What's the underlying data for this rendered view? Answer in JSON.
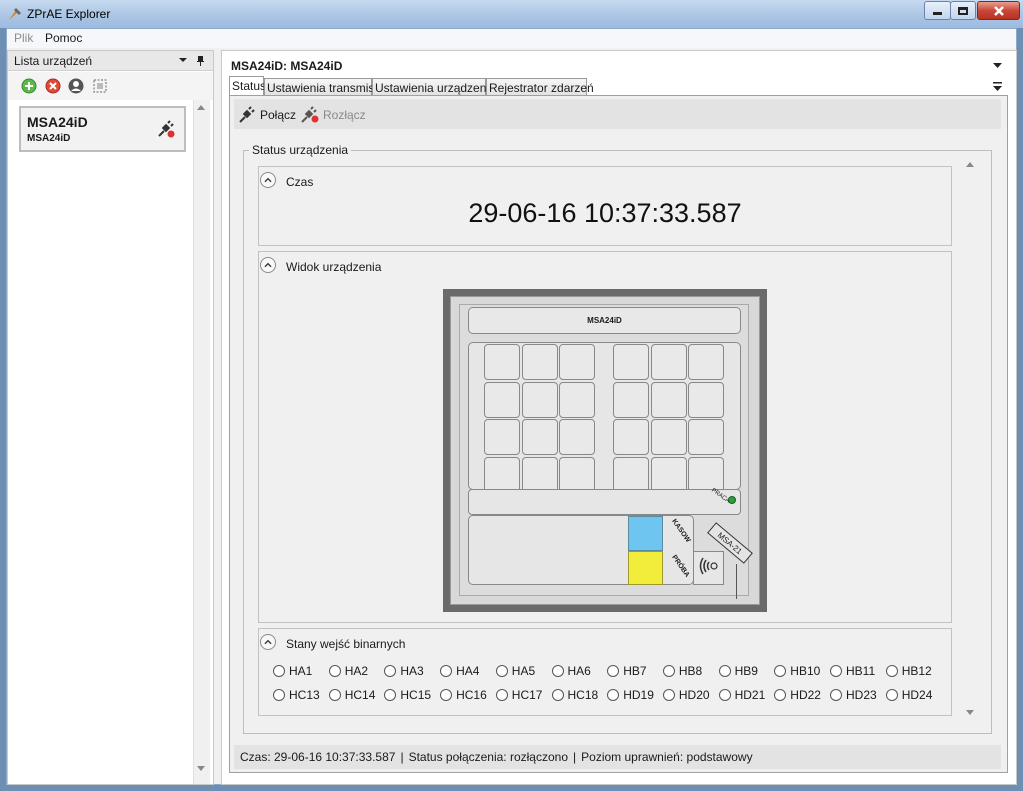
{
  "window": {
    "title": "ZPrAE Explorer"
  },
  "menu": [
    "Plik",
    "Pomoc"
  ],
  "left_panel": {
    "header": "Lista urządzeń",
    "toolbar_icons": [
      "add-icon",
      "remove-icon",
      "user-icon",
      "select-icon"
    ],
    "device": {
      "name": "MSA24iD",
      "subname": "MSA24iD"
    }
  },
  "right_panel": {
    "title": "MSA24iD: MSA24iD",
    "tabs": [
      "Status",
      "Ustawienia transmisji",
      "Ustawienia urządzenia",
      "Rejestrator zdarzeń"
    ],
    "toolbar": {
      "connect": "Połącz",
      "disconnect": "Rozłącz"
    },
    "group_title": "Status urządzenia",
    "sections": {
      "time": {
        "label": "Czas",
        "value": "29-06-16 10:37:33.587"
      },
      "device_view": {
        "label": "Widok urządzenia"
      },
      "inputs": {
        "label": "Stany wejść binarnych"
      }
    },
    "device_panel": {
      "model": "MSA24iD",
      "praca": "PRACA",
      "kasow": "KASOW",
      "proba": "PRÓBA",
      "sticker": "MSA-21",
      "button_colors": {
        "kasow": "#6ec6f0",
        "proba": "#f2ec3a",
        "praca_led": "#2e9e3a"
      }
    },
    "binary_inputs": [
      [
        "HA1",
        "HA2",
        "HA3",
        "HA4",
        "HA5",
        "HA6",
        "HB7",
        "HB8",
        "HB9",
        "HB10",
        "HB11",
        "HB12"
      ],
      [
        "HC13",
        "HC14",
        "HC15",
        "HC16",
        "HC17",
        "HC18",
        "HD19",
        "HD20",
        "HD21",
        "HD22",
        "HD23",
        "HD24"
      ]
    ],
    "status_bar": {
      "time": "Czas: 29-06-16 10:37:33.587",
      "sep1": "|",
      "connection": "Status połączenia: rozłączono",
      "sep2": "|",
      "permission": "Poziom uprawnień: podstawowy"
    }
  }
}
